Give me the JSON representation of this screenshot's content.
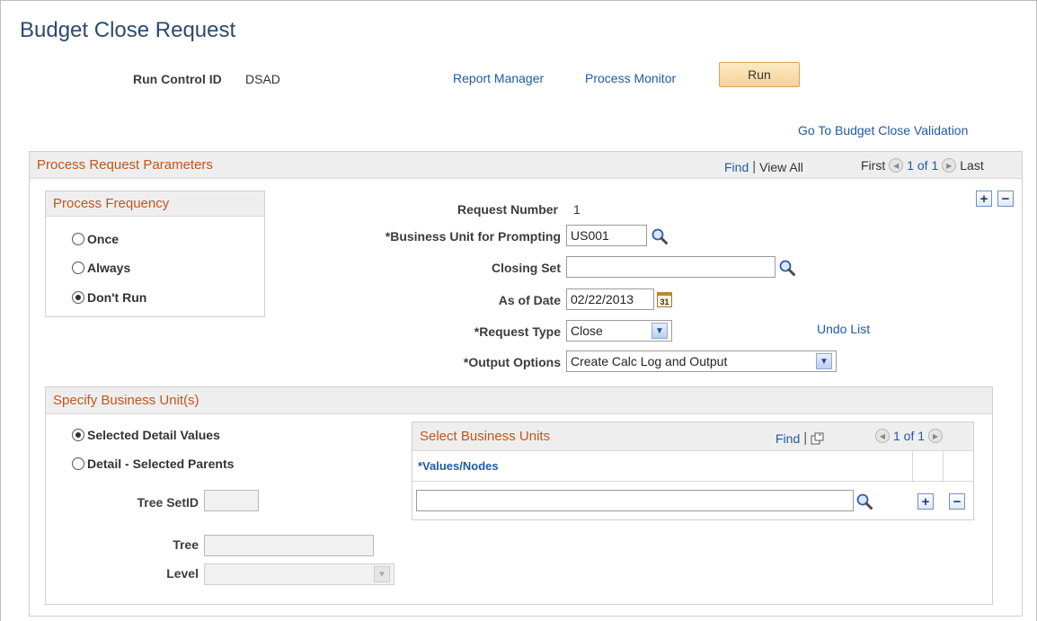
{
  "page": {
    "title": "Budget Close Request"
  },
  "header": {
    "run_control_label": "Run Control ID",
    "run_control_value": "DSAD",
    "report_manager": "Report Manager",
    "process_monitor": "Process Monitor",
    "run_button": "Run",
    "go_to_validation": "Go To Budget Close Validation"
  },
  "params_panel": {
    "title": "Process Request Parameters",
    "find": "Find",
    "view_all": "View All",
    "first": "First",
    "count": "1 of 1",
    "last": "Last"
  },
  "frequency": {
    "title": "Process Frequency",
    "options": [
      "Once",
      "Always",
      "Don't Run"
    ],
    "selected": "Don't Run"
  },
  "form": {
    "request_number_label": "Request Number",
    "request_number_value": "1",
    "bu_prompt_label": "*Business Unit for Prompting",
    "bu_prompt_value": "US001",
    "closing_set_label": "Closing Set",
    "closing_set_value": "",
    "as_of_date_label": "As of Date",
    "as_of_date_value": "02/22/2013",
    "calendar_glyph": "31",
    "request_type_label": "*Request Type",
    "request_type_value": "Close",
    "undo_list": "Undo List",
    "output_options_label": "*Output Options",
    "output_options_value": "Create Calc Log and Output"
  },
  "specify_bu": {
    "title": "Specify Business Unit(s)",
    "options": [
      "Selected Detail Values",
      "Detail - Selected Parents"
    ],
    "selected": "Selected Detail Values",
    "tree_setid_label": "Tree SetID",
    "tree_label": "Tree",
    "level_label": "Level"
  },
  "bu_grid": {
    "title": "Select Business Units",
    "find": "Find",
    "count": "1 of 1",
    "column": "*Values/Nodes",
    "row_value": ""
  },
  "colors": {
    "accent_orange": "#c0561c",
    "link_blue": "#1f5aa6",
    "title_blue": "#2d4a6e",
    "run_button": "#f7d295"
  }
}
